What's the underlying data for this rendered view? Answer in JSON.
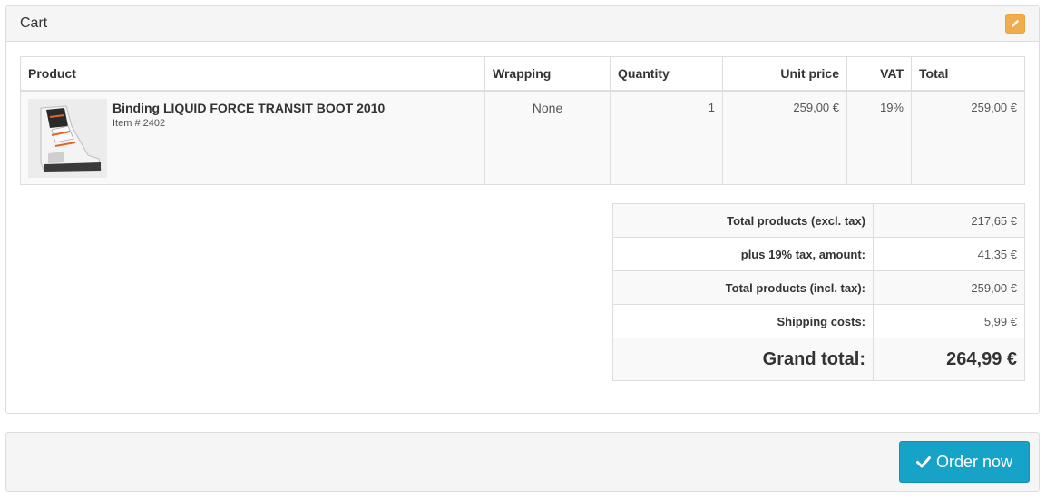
{
  "panel": {
    "title": "Cart"
  },
  "table": {
    "headers": {
      "product": "Product",
      "wrapping": "Wrapping",
      "quantity": "Quantity",
      "unit_price": "Unit price",
      "vat": "VAT",
      "total": "Total"
    },
    "rows": [
      {
        "name": "Binding LIQUID FORCE TRANSIT BOOT 2010",
        "sku": "Item # 2402",
        "wrapping": "None",
        "quantity": "1",
        "unit_price": "259,00 €",
        "vat": "19%",
        "total": "259,00 €"
      }
    ]
  },
  "totals": {
    "excl_label": "Total products (excl. tax)",
    "excl_value": "217,65 €",
    "tax_label": "plus 19% tax, amount:",
    "tax_value": "41,35 €",
    "incl_label": "Total products (incl. tax):",
    "incl_value": "259,00 €",
    "shipping_label": "Shipping costs:",
    "shipping_value": "5,99 €",
    "grand_label": "Grand total:",
    "grand_value": "264,99 €"
  },
  "footer": {
    "order_label": "Order now"
  },
  "colors": {
    "edit_button": "#f0ad4e",
    "order_button": "#17a2c8"
  },
  "icons": {
    "edit": "pencil-icon",
    "order": "check-icon"
  }
}
